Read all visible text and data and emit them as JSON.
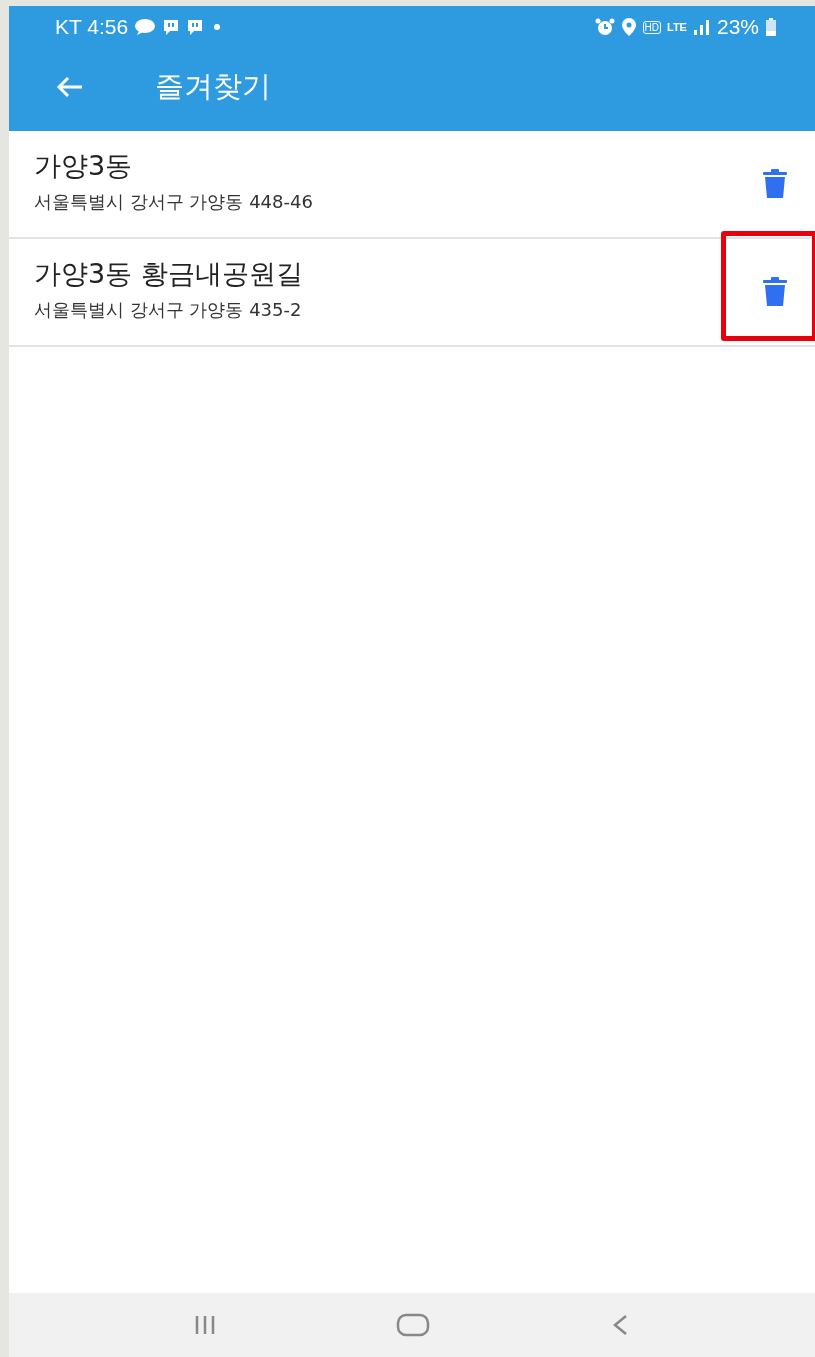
{
  "status_bar": {
    "carrier_time": "KT 4:56",
    "network_badges": [
      "HD",
      "LTE"
    ],
    "battery": "23%"
  },
  "app_bar": {
    "title": "즐겨찾기"
  },
  "favorites": [
    {
      "name": "가양3동",
      "address": "서울특별시 강서구 가양동 448-46",
      "highlighted": false
    },
    {
      "name": "가양3동 황금내공원길",
      "address": "서울특별시 강서구 가양동 435-2",
      "highlighted": true
    }
  ]
}
